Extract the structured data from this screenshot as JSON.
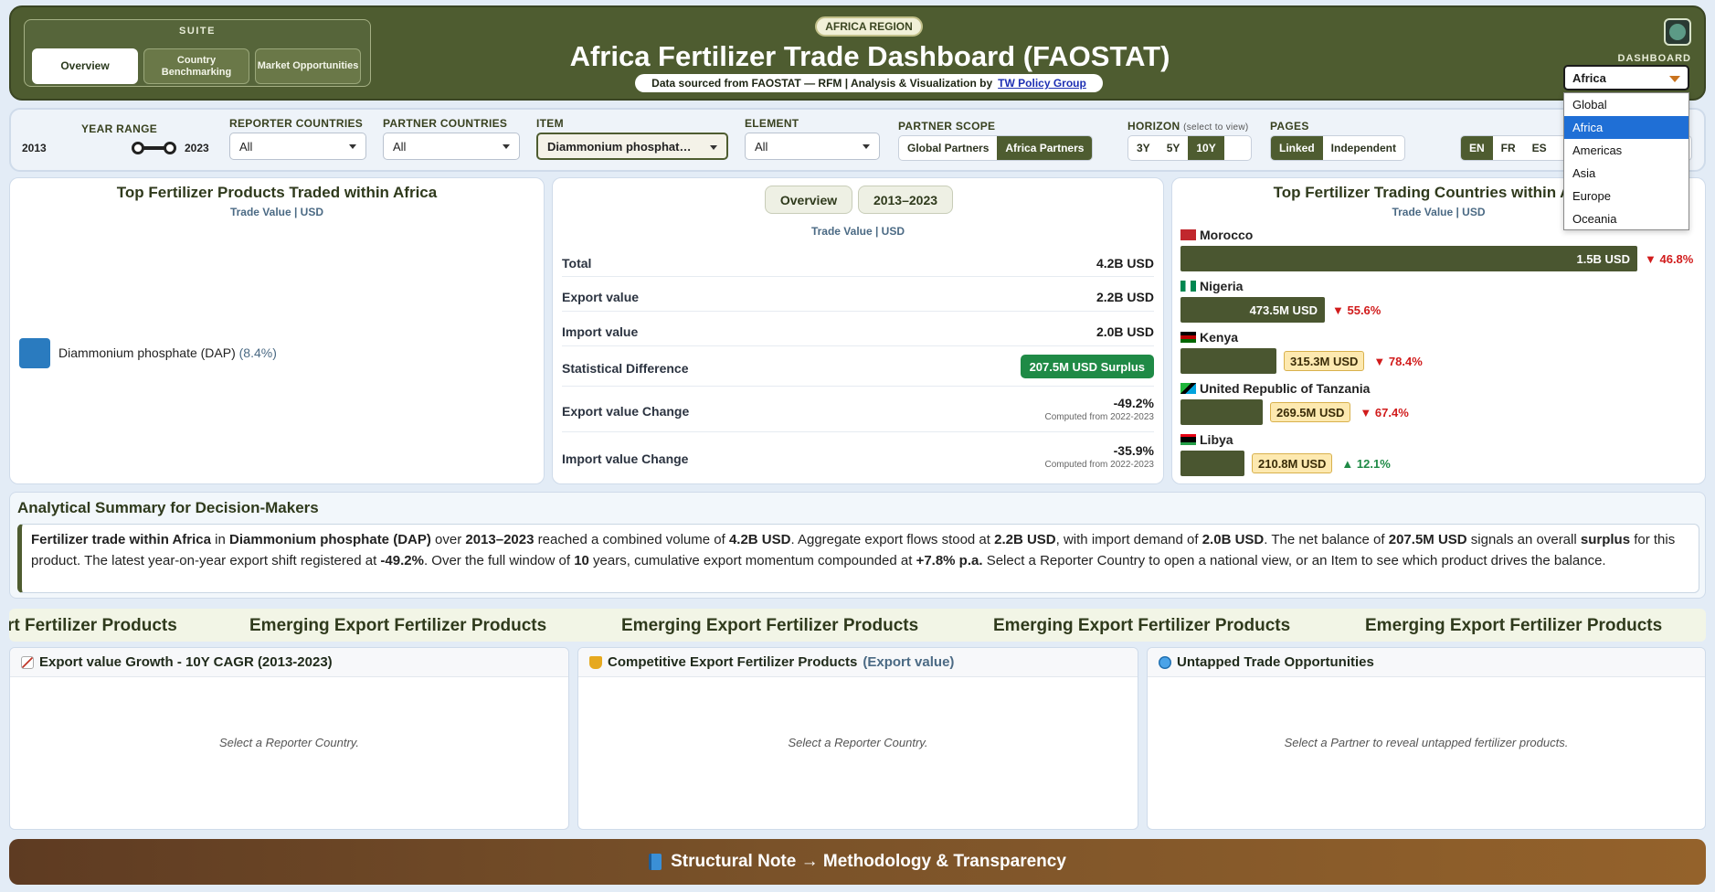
{
  "header": {
    "suite_label": "SUITE",
    "suite_tabs": [
      {
        "label": "Overview"
      },
      {
        "label": "Country Benchmarking"
      },
      {
        "label": "Market Opportunities"
      }
    ],
    "region_badge": "AFRICA REGION",
    "title": "Africa Fertilizer Trade Dashboard (FAOSTAT)",
    "subtitle_prefix": "Data sourced from FAOSTAT — RFM | Analysis & Visualization by",
    "subtitle_link": "TW Policy Group",
    "dashboard_label": "DASHBOARD",
    "dashboard_value": "Africa",
    "dashboard_options": [
      "Global",
      "Africa",
      "Americas",
      "Asia",
      "Europe",
      "Oceania"
    ]
  },
  "filters": {
    "year_range_label": "YEAR RANGE",
    "year_start": "2013",
    "year_end": "2023",
    "reporter_label": "REPORTER COUNTRIES",
    "reporter_value": "All",
    "partner_label": "PARTNER COUNTRIES",
    "partner_value": "All",
    "item_label": "ITEM",
    "item_value": "Diammonium phosphat…",
    "element_label": "ELEMENT",
    "element_value": "All",
    "scope_label": "PARTNER SCOPE",
    "scope_options": [
      "Global Partners",
      "Africa Partners"
    ],
    "horizon_label": "HORIZON",
    "horizon_hint": "(select to view)",
    "horizon_options": [
      "3Y",
      "5Y",
      "10Y"
    ],
    "pages_label": "PAGES",
    "pages_options": [
      "Linked",
      "Independent"
    ],
    "languages": [
      "EN",
      "FR",
      "ES"
    ]
  },
  "products_card": {
    "title": "Top Fertilizer Products Traded within Africa",
    "subtitle": "Trade Value | USD",
    "legend_name": "Diammonium phosphate (DAP)",
    "legend_pct": "(8.4%)",
    "legend_color": "#2a7bbf"
  },
  "kpi_card": {
    "tabs": [
      "Overview",
      "2013–2023"
    ],
    "subtitle": "Trade Value | USD",
    "rows": [
      {
        "label": "Total",
        "value": "4.2B USD"
      },
      {
        "label": "Export value",
        "value": "2.2B USD"
      },
      {
        "label": "Import value",
        "value": "2.0B USD"
      }
    ],
    "stat_diff_label": "Statistical Difference",
    "stat_diff_value": "207.5M USD Surplus",
    "export_change_label": "Export value Change",
    "export_change_value": "-49.2%",
    "export_change_note": "Computed from 2022-2023",
    "import_change_label": "Import value Change",
    "import_change_value": "-35.9%",
    "import_change_note": "Computed from 2022-2023"
  },
  "countries_card": {
    "title": "Top Fertilizer Trading Countries within Africa",
    "subtitle": "Trade Value | USD",
    "countries": [
      {
        "name": "Morocco",
        "value": "1.5B USD",
        "change": "▼ 46.8%",
        "direction": "down",
        "share": 1.0
      },
      {
        "name": "Nigeria",
        "value": "473.5M USD",
        "change": "▼ 55.6%",
        "direction": "down",
        "share": 0.316
      },
      {
        "name": "Kenya",
        "value": "315.3M USD",
        "change": "▼ 78.4%",
        "direction": "down",
        "share": 0.21
      },
      {
        "name": "United Republic of Tanzania",
        "value": "269.5M USD",
        "change": "▼ 67.4%",
        "direction": "down",
        "share": 0.18
      },
      {
        "name": "Libya",
        "value": "210.8M USD",
        "change": "▲ 12.1%",
        "direction": "up",
        "share": 0.14
      }
    ]
  },
  "summary": {
    "title": "Analytical Summary for Decision-Makers",
    "s1": "Fertilizer trade within Africa",
    "s2": " in ",
    "s3": "Diammonium phosphate (DAP)",
    "s4": " over ",
    "s5": "2013–2023",
    "s6": " reached a combined volume of ",
    "s7": "4.2B USD",
    "s8": ". Aggregate export flows stood at ",
    "s9": "2.2B USD",
    "s10": ", with import demand of ",
    "s11": "2.0B USD",
    "s12": ". The net balance of ",
    "s13": "207.5M USD",
    "s14": " signals an overall ",
    "s15": "surplus",
    "s16": " for this product. The latest year-on-year export shift registered at ",
    "s17": "-49.2%",
    "s18": ". Over the full window of ",
    "s19": "10",
    "s20": " years, cumulative export momentum compounded at ",
    "s21": "+7.8% p.a.",
    "s22": " Select a Reporter Country to open a national view, or an Item to see which product drives the balance."
  },
  "ticker": {
    "items": [
      "rt Fertilizer Products",
      "Emerging Export Fertilizer Products",
      "Emerging Export Fertilizer Products",
      "Emerging Export Fertilizer Products",
      "Emerging Export Fertilizer Products"
    ]
  },
  "panels": [
    {
      "title": "Export value Growth - 10Y CAGR (2013-2023)",
      "muted": "",
      "message": "Select a Reporter Country.",
      "icon": "chart-up-icon"
    },
    {
      "title": "Competitive Export Fertilizer Products",
      "muted": "(Export value)",
      "message": "Select a Reporter Country.",
      "icon": "trophy-icon"
    },
    {
      "title": "Untapped Trade Opportunities",
      "muted": "",
      "message": "Select a Partner to reveal untapped fertilizer products.",
      "icon": "globe-icon"
    }
  ],
  "footer": {
    "label": "Structural Note → Methodology & Transparency"
  }
}
